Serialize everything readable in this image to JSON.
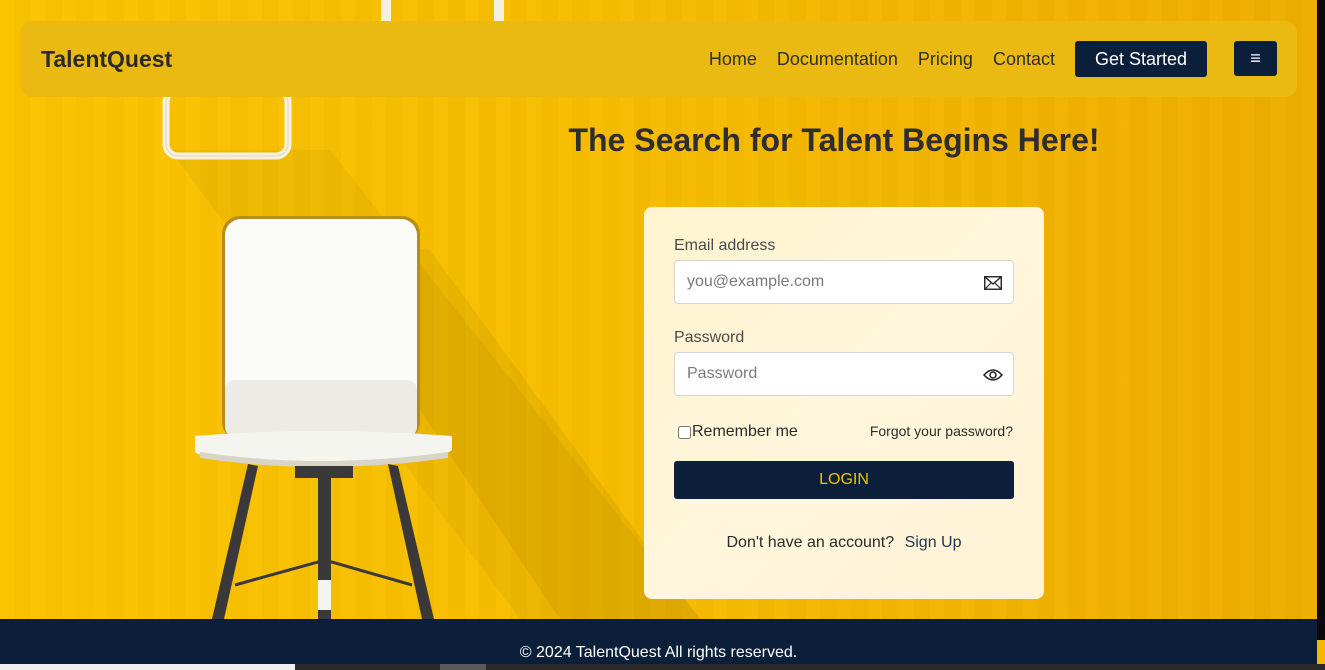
{
  "navbar": {
    "brand": "TalentQuest",
    "links": [
      "Home",
      "Documentation",
      "Pricing",
      "Contact"
    ],
    "cta_label": "Get Started",
    "menu_icon": "hamburger-icon",
    "menu_glyph": "≡"
  },
  "hero": {
    "title": "The Search for Talent Begins Here!"
  },
  "login": {
    "email_label": "Email address",
    "email_placeholder": "you@example.com",
    "email_value": "",
    "email_icon": "envelope-icon",
    "password_label": "Password",
    "password_placeholder": "Password",
    "password_value": "",
    "password_icon": "eye-icon",
    "remember_label": "Remember me",
    "remember_checked": false,
    "forgot_label": "Forgot your password?",
    "submit_label": "LOGIN",
    "no_account_text": "Don't have an account?",
    "signup_label": "Sign Up"
  },
  "footer": {
    "copyright": "© 2024 TalentQuest All rights reserved."
  },
  "colors": {
    "background_yellow": "#f7bd00",
    "navbar": "#ebba12",
    "navy": "#0b1f3a",
    "login_text": "#f2c200",
    "card": "#fff4cf"
  }
}
